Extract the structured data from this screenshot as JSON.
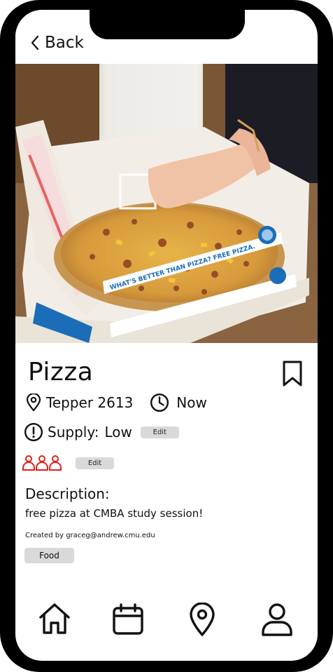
{
  "header": {
    "back_label": "Back"
  },
  "event": {
    "title": "Pizza",
    "location": "Tepper 2613",
    "time": "Now",
    "supply_label": "Supply:",
    "supply_level": "Low",
    "supply_edit_label": "Edit",
    "attendees_edit_label": "Edit",
    "description_heading": "Description:",
    "description": "free pizza at CMBA study session!",
    "created_by": "Created by graceg@andrew.cmu.edu",
    "tag": "Food",
    "box_text": "WHAT'S BETTER THAN PIZZA? FREE PIZZA."
  },
  "icons": {
    "back": "chevron-left-icon",
    "bookmark": "bookmark-icon",
    "location": "map-pin-icon",
    "time": "clock-icon",
    "supply": "alert-circle-icon",
    "attendees": "people-group-icon"
  },
  "nav": [
    {
      "name": "home",
      "icon": "home-icon"
    },
    {
      "name": "calendar",
      "icon": "calendar-icon"
    },
    {
      "name": "map",
      "icon": "map-pin-icon"
    },
    {
      "name": "profile",
      "icon": "user-icon"
    }
  ],
  "colors": {
    "attendees_icon": "#e0201b",
    "chip_bg": "#d9d9d9"
  }
}
